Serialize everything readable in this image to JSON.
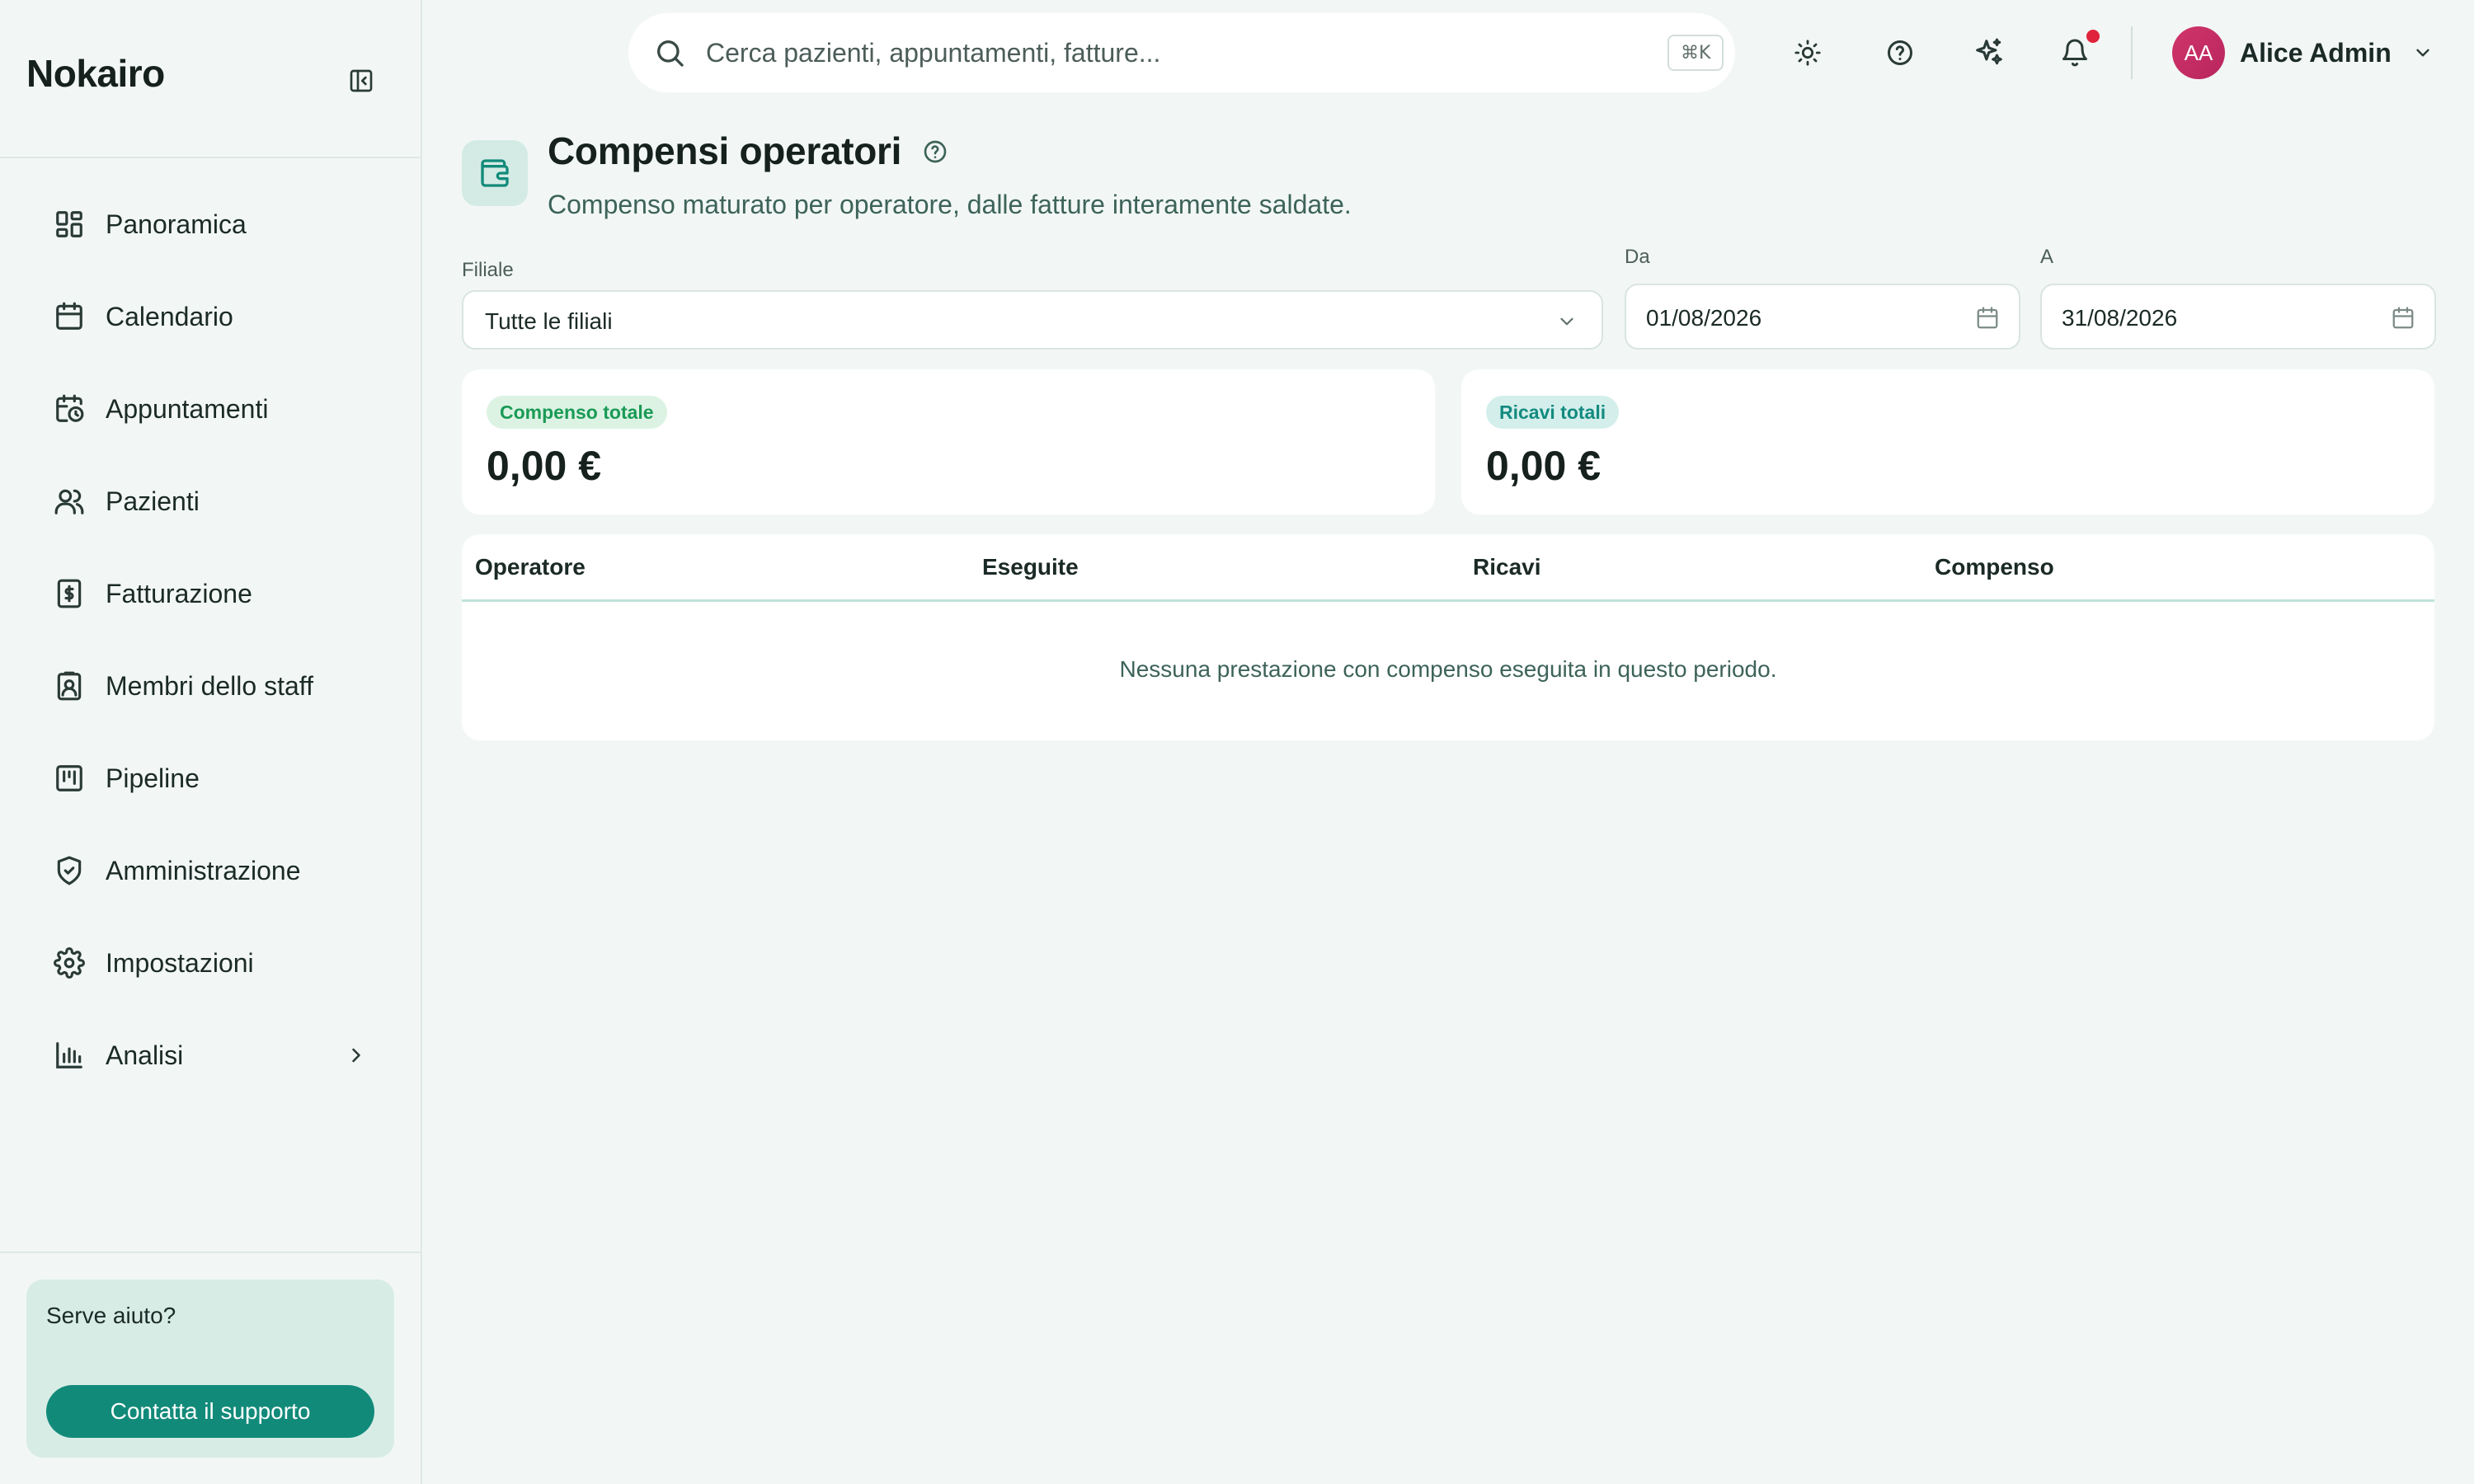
{
  "sidebar": {
    "brand": "Nokairo",
    "items": [
      {
        "label": "Panoramica",
        "icon": "dashboard-icon"
      },
      {
        "label": "Calendario",
        "icon": "calendar-icon"
      },
      {
        "label": "Appuntamenti",
        "icon": "calendar-clock-icon"
      },
      {
        "label": "Pazienti",
        "icon": "users-icon"
      },
      {
        "label": "Fatturazione",
        "icon": "invoice-icon"
      },
      {
        "label": "Membri dello staff",
        "icon": "badge-icon"
      },
      {
        "label": "Pipeline",
        "icon": "kanban-icon"
      },
      {
        "label": "Amministrazione",
        "icon": "shield-icon"
      },
      {
        "label": "Impostazioni",
        "icon": "gear-icon"
      },
      {
        "label": "Analisi",
        "icon": "bar-chart-icon"
      }
    ],
    "help": {
      "title": "Serve aiuto?",
      "button": "Contatta il supporto"
    }
  },
  "topbar": {
    "search_placeholder": "Cerca pazienti, appuntamenti, fatture...",
    "shortcut": "⌘K",
    "user": {
      "initials": "AA",
      "name": "Alice Admin"
    }
  },
  "page": {
    "title": "Compensi operatori",
    "subtitle": "Compenso maturato per operatore, dalle fatture interamente saldate."
  },
  "filters": {
    "branch_label": "Filiale",
    "branch_value": "Tutte le filiali",
    "from_label": "Da",
    "from_value": "01/08/2026",
    "to_label": "A",
    "to_value": "31/08/2026"
  },
  "stats": {
    "total_comp_label": "Compenso totale",
    "total_comp_value": "0,00 €",
    "total_rev_label": "Ricavi totali",
    "total_rev_value": "0,00 €"
  },
  "table": {
    "columns": [
      "Operatore",
      "Eseguite",
      "Ricavi",
      "Compenso"
    ],
    "empty": "Nessuna prestazione con compenso eseguita in questo periodo."
  },
  "colors": {
    "accent": "#128a7a",
    "background": "#f2f7f5",
    "notification": "#e0243b",
    "avatar": "#c42f66"
  }
}
